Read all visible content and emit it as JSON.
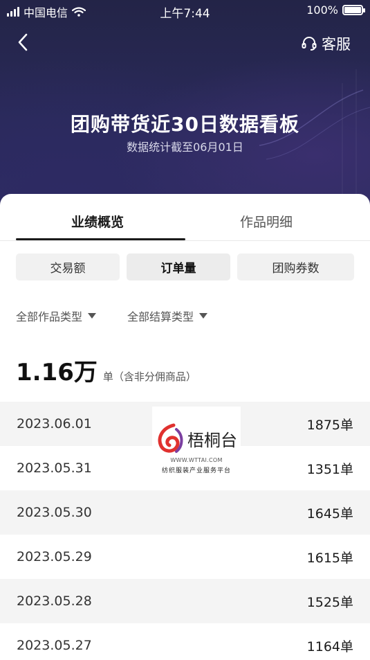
{
  "status_bar": {
    "carrier": "中国电信",
    "time": "上午7:44",
    "battery_pct": "100%",
    "battery_level": 1.0
  },
  "nav": {
    "service_label": "客服"
  },
  "header": {
    "title": "团购带货近30日数据看板",
    "subtitle": "数据统计截至06月01日"
  },
  "tabs": [
    {
      "label": "业绩概览",
      "active": true
    },
    {
      "label": "作品明细",
      "active": false
    }
  ],
  "metrics": [
    {
      "label": "交易额",
      "active": false
    },
    {
      "label": "订单量",
      "active": true
    },
    {
      "label": "团购券数",
      "active": false
    }
  ],
  "filters": [
    {
      "label": "全部作品类型"
    },
    {
      "label": "全部结算类型"
    }
  ],
  "summary": {
    "value": "1.16万",
    "unit": "单（含非分佣商品）"
  },
  "rows": [
    {
      "date": "2023.06.01",
      "value": "1875单"
    },
    {
      "date": "2023.05.31",
      "value": "1351单"
    },
    {
      "date": "2023.05.30",
      "value": "1645单"
    },
    {
      "date": "2023.05.29",
      "value": "1615单"
    },
    {
      "date": "2023.05.28",
      "value": "1525单"
    },
    {
      "date": "2023.05.27",
      "value": "1164单"
    }
  ],
  "watermark": {
    "name": "梧桐台",
    "url": "WWW.WTTAI.COM",
    "slogan": "纺织服装产业服务平台"
  },
  "colors": {
    "hero_bg": "#2a2a5a",
    "accent_logo_red": "#e0312f",
    "accent_logo_purple": "#7b3fa0"
  }
}
